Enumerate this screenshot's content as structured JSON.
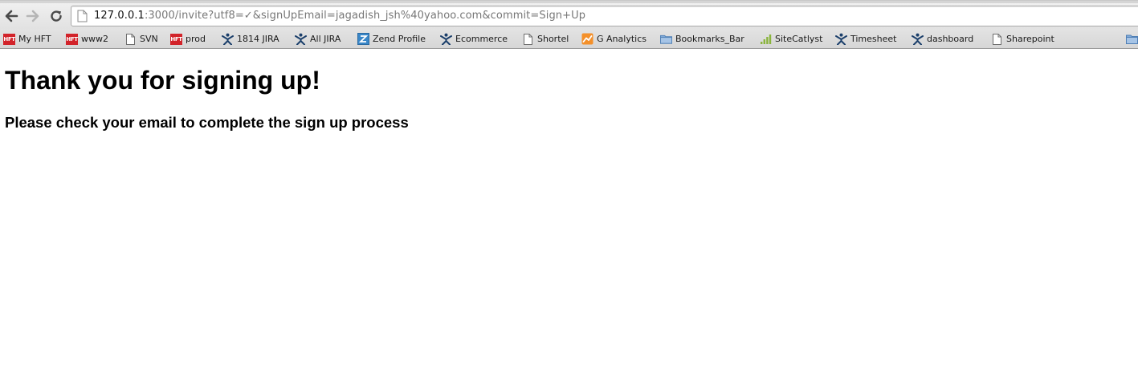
{
  "browser": {
    "address_bar": {
      "host": "127.0.0.1",
      "rest": ":3000/invite?utf8=✓&signUpEmail=jagadish_jsh%40yahoo.com&commit=Sign+Up"
    },
    "bookmarks": [
      {
        "label": "My HFT",
        "icon": "hft-icon"
      },
      {
        "label": "www2",
        "icon": "hft-icon"
      },
      {
        "label": "SVN",
        "icon": "page-icon"
      },
      {
        "label": "prod",
        "icon": "hft-icon"
      },
      {
        "label": "1814 JIRA",
        "icon": "jira-icon"
      },
      {
        "label": "All JIRA",
        "icon": "jira-icon"
      },
      {
        "label": "Zend Profile",
        "icon": "zend-icon"
      },
      {
        "label": "Ecommerce",
        "icon": "jira-icon"
      },
      {
        "label": "Shortel",
        "icon": "page-icon"
      },
      {
        "label": "G Analytics",
        "icon": "analytics-icon"
      },
      {
        "label": "Bookmarks_Bar",
        "icon": "folder-icon"
      },
      {
        "label": "SiteCatlyst",
        "icon": "sitecatalyst-icon"
      },
      {
        "label": "Timesheet",
        "icon": "jira-icon"
      },
      {
        "label": "dashboard",
        "icon": "jira-icon"
      },
      {
        "label": "Sharepoint",
        "icon": "page-icon"
      }
    ],
    "hft_icon_text": "HFT"
  },
  "page": {
    "title": "Thank you for signing up!",
    "subtitle": "Please check your email to complete the sign up process"
  },
  "colors": {
    "hft_red": "#d2232a",
    "jira_blue": "#1b3f6b",
    "zend_blue": "#3a87c8",
    "analytics_orange": "#f4902a",
    "folder_blue": "#7fa8d6",
    "sitecatalyst_green": "#8ab43c"
  }
}
